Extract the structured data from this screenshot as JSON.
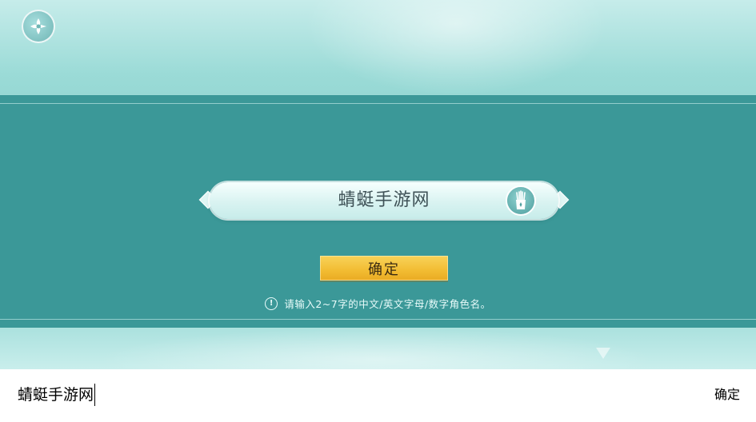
{
  "game": {
    "back_icon": "flower-back-icon",
    "name_box": {
      "value": "蜻蜓手游网",
      "random_icon": "random-name-icon"
    },
    "confirm_label": "确定",
    "hint_icon": "exclamation-icon",
    "hint_icon_text": "!",
    "hint": "请输入2~7字的中文/英文字母/数字角色名。",
    "colors": {
      "band": "#3b9898",
      "confirm_button": "#f2bc32",
      "sky": "#9bdbd7"
    }
  },
  "ime": {
    "input_text": "蜻蜓手游网",
    "confirm_label": "确定"
  }
}
